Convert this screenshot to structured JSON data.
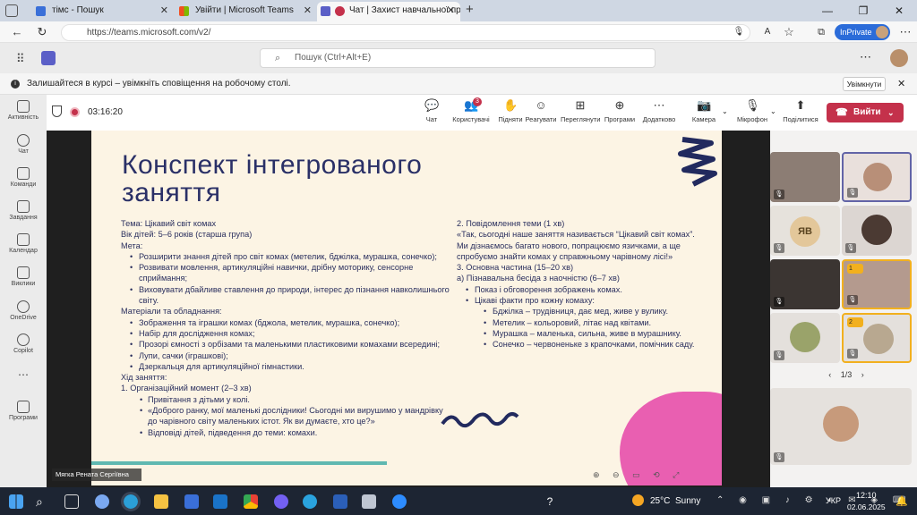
{
  "browser": {
    "tabs": [
      {
        "label": "тімс - Пошук",
        "color": "#3a6fd8"
      },
      {
        "label": "Увійти | Microsoft Teams",
        "color": "#2a7d3b"
      },
      {
        "label": "Чат | Захист навчальної пр",
        "color": "#c4314b"
      }
    ],
    "url": "https://teams.microsoft.com/v2/",
    "inprivate": "InPrivate"
  },
  "teams": {
    "search_placeholder": "Пошук (Ctrl+Alt+E)",
    "notice": "Залишайтеся в курсі – увімкніть сповіщення на робочому столі.",
    "notice_button": "Увімкнути",
    "rail": [
      "Активність",
      "Чат",
      "Команди",
      "Завдання",
      "Календар",
      "Виклики",
      "OneDrive",
      "Copilot",
      "Програми"
    ],
    "call": {
      "timer": "03:16:20",
      "buttons": [
        "Чат",
        "Користувачі",
        "Підняти",
        "Реагувати",
        "Переглянути",
        "Програми",
        "Додатково"
      ],
      "users_badge": "3",
      "camera": "Камера",
      "mic": "Мікрофон",
      "share": "Поділитися",
      "leave": "Вийти"
    },
    "presenter": "Мягка Рената Сергіївна",
    "participants": {
      "initials": "ЯВ",
      "hand1": "1",
      "hand2": "2",
      "page": "1/3"
    }
  },
  "slide": {
    "title1": "Конспект інтегрованого",
    "title2": "заняття",
    "left": [
      {
        "t": "Тема: Цікавий світ комах",
        "c": ""
      },
      {
        "t": "Вік дітей: 5–6 років (старша група)",
        "c": ""
      },
      {
        "t": "Мета:",
        "c": ""
      },
      {
        "t": "Розширити знання дітей про світ комах (метелик, бджілка, мурашка, сонечко);",
        "c": "ind"
      },
      {
        "t": "Розвивати мовлення, артикуляційні навички, дрібну моторику, сенсорне сприймання;",
        "c": "ind"
      },
      {
        "t": "Виховувати дбайливе ставлення до природи, інтерес до пізнання навколишнього світу.",
        "c": "ind"
      },
      {
        "t": "Матеріали та обладнання:",
        "c": ""
      },
      {
        "t": "Зображення та іграшки комах (бджола, метелик, мурашка, сонечко);",
        "c": "ind"
      },
      {
        "t": "Набір для дослідження комах;",
        "c": "ind"
      },
      {
        "t": "Прозорі ємності з орбізами та маленькими пластиковими комахами всередині;",
        "c": "ind"
      },
      {
        "t": "Лупи, сачки (іграшкові);",
        "c": "ind"
      },
      {
        "t": "Дзеркальця для артикуляційної гімнастики.",
        "c": "ind"
      },
      {
        "t": "Хід заняття:",
        "c": ""
      },
      {
        "t": "1. Організаційний момент (2–3 хв)",
        "c": ""
      },
      {
        "t": "Привітання з дітьми у колі.",
        "c": "ind2"
      },
      {
        "t": "«Доброго ранку, мої маленькі дослідники! Сьогодні ми вирушимо у мандрівку до чарівного світу маленьких істот. Як ви думаєте, хто це?»",
        "c": "ind2"
      },
      {
        "t": "Відповіді дітей, підведення до теми: комахи.",
        "c": "ind2"
      }
    ],
    "right": [
      {
        "t": "2. Повідомлення теми (1 хв)",
        "c": ""
      },
      {
        "t": "«Так, сьогодні наше заняття називається “Цікавий світ комах”. Ми дізнаємось багато нового, попрацюємо язичками, а ще спробуємо знайти комах у справжньому чарівному лісі!»",
        "c": ""
      },
      {
        "t": "3. Основна частина (15–20 хв)",
        "c": ""
      },
      {
        "t": "а) Пізнавальна бесіда з наочністю (6–7 хв)",
        "c": ""
      },
      {
        "t": "Показ і обговорення зображень комах.",
        "c": "ind"
      },
      {
        "t": "Цікаві факти про кожну комаху:",
        "c": "ind"
      },
      {
        "t": "Бджілка – трудівниця, дає мед, живе у вулику.",
        "c": "ind3"
      },
      {
        "t": "Метелик – кольоровий, літає над квітами.",
        "c": "ind3"
      },
      {
        "t": "Мурашка – маленька, сильна, живе в мурашнику.",
        "c": "ind3"
      },
      {
        "t": "Сонечко – червоненьке з крапочками, помічник саду.",
        "c": "ind3"
      }
    ]
  },
  "taskbar": {
    "weather": "25°C",
    "weather_desc": "Sunny",
    "lang": "УКР",
    "time": "12:10",
    "date": "02.06.2025"
  }
}
